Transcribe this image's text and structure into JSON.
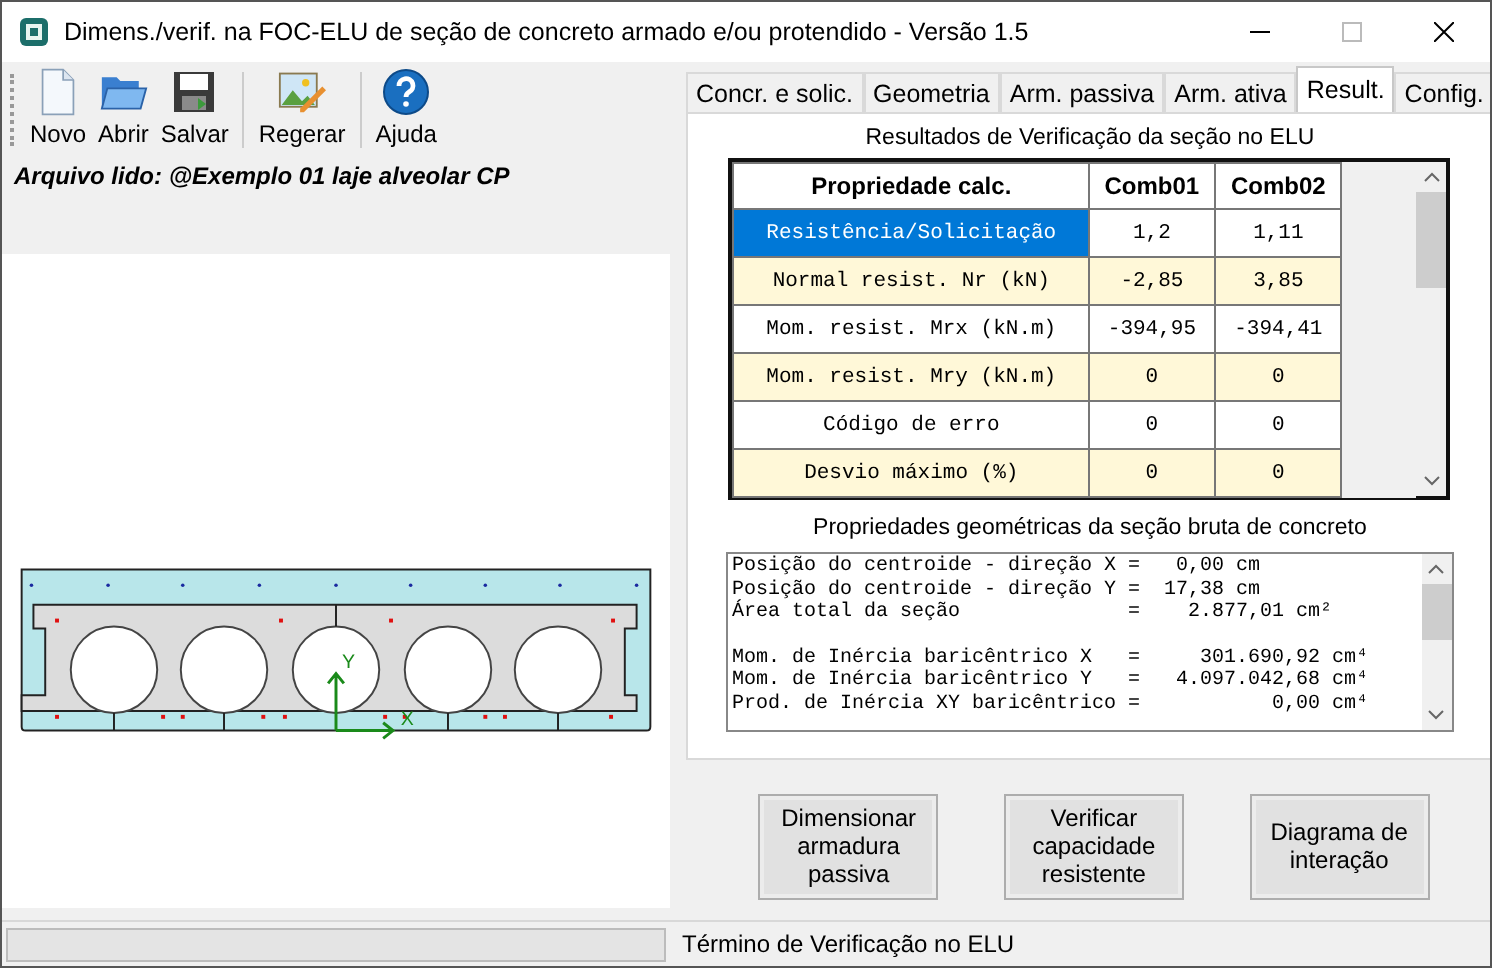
{
  "window": {
    "title": "Dimens./verif. na FOC-ELU de seção de concreto armado e/ou protendido - Versão 1.5"
  },
  "toolbar": [
    [
      {
        "label": "Novo",
        "kind": "new"
      },
      {
        "label": "Abrir",
        "kind": "open"
      },
      {
        "label": "Salvar",
        "kind": "save"
      }
    ],
    [
      {
        "label": "Regerar",
        "kind": "regen"
      }
    ],
    [
      {
        "label": "Ajuda",
        "kind": "help"
      }
    ]
  ],
  "file_label": "Arquivo lido: @Exemplo 01 laje alveolar CP",
  "section": {
    "axes": {
      "x": "X",
      "y": "Y"
    }
  },
  "tabs": [
    {
      "label": "Concr. e solic.",
      "selected": false
    },
    {
      "label": "Geometria",
      "selected": false
    },
    {
      "label": "Arm. passiva",
      "selected": false
    },
    {
      "label": "Arm. ativa",
      "selected": false
    },
    {
      "label": "Result.",
      "selected": true
    },
    {
      "label": "Config.",
      "selected": false
    }
  ],
  "results": {
    "title": "Resultados de Verificação da seção no ELU",
    "columns": [
      "Propriedade calc.",
      "Comb01",
      "Comb02"
    ],
    "rows": [
      {
        "cells": [
          "Resistência/Solicitação",
          "1,2",
          "1,11"
        ],
        "selected": true
      },
      {
        "cells": [
          "Normal resist. Nr (kN)",
          "-2,85",
          "3,85"
        ],
        "selected": false
      },
      {
        "cells": [
          "Mom. resist. Mrx (kN.m)",
          "-394,95",
          "-394,41"
        ],
        "selected": false
      },
      {
        "cells": [
          "Mom. resist. Mry (kN.m)",
          "0",
          "0"
        ],
        "selected": false
      },
      {
        "cells": [
          "Código de erro",
          "0",
          "0"
        ],
        "selected": false
      },
      {
        "cells": [
          "Desvio máximo (%)",
          "0",
          "0"
        ],
        "selected": false
      }
    ]
  },
  "geometry": {
    "title": "Propriedades geométricas da seção bruta de concreto",
    "groups": [
      [
        "Posição do centroide - direção X =   0,00 cm",
        "Posição do centroide - direção Y =  17,38 cm",
        "Área total da seção              =    2.877,01 cm²"
      ],
      [
        "Mom. de Inércia baricêntrico X   =     301.690,92 cm⁴",
        "Mom. de Inércia baricêntrico Y   =   4.097.042,68 cm⁴",
        "Prod. de Inércia XY baricêntrico =           0,00 cm⁴"
      ]
    ]
  },
  "buttons": [
    {
      "lines": [
        "Dimensionar",
        "armadura",
        "passiva"
      ]
    },
    {
      "lines": [
        "Verificar",
        "capacidade",
        "resistente"
      ]
    },
    {
      "lines": [
        "Diagrama de",
        "interação"
      ]
    }
  ],
  "status_bar": {
    "progress": {
      "level": 0
    },
    "message": "Término de Verificação no ELU"
  }
}
